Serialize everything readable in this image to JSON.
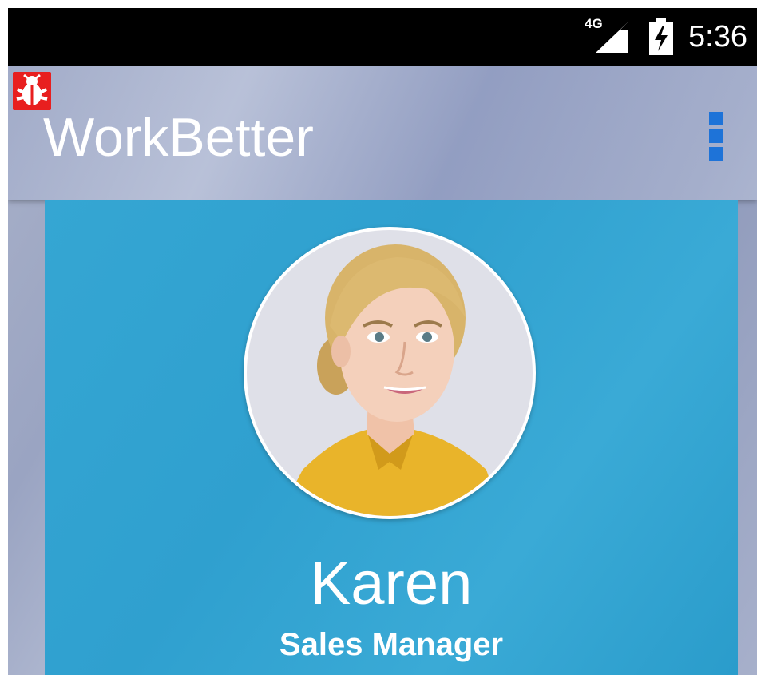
{
  "status_bar": {
    "network_label": "4G",
    "time": "5:36",
    "icons": [
      "signal-icon",
      "battery-charging-icon"
    ]
  },
  "app_bar": {
    "title": "WorkBetter",
    "debug_icon": "bug-icon",
    "menu_icon": "overflow-menu-icon"
  },
  "profile": {
    "name": "Karen",
    "role": "Sales Manager"
  },
  "colors": {
    "status_bar": "#000000",
    "card": "#31a2d1",
    "menu_dots": "#1e73d8",
    "debug_badge": "#e81f1f"
  }
}
